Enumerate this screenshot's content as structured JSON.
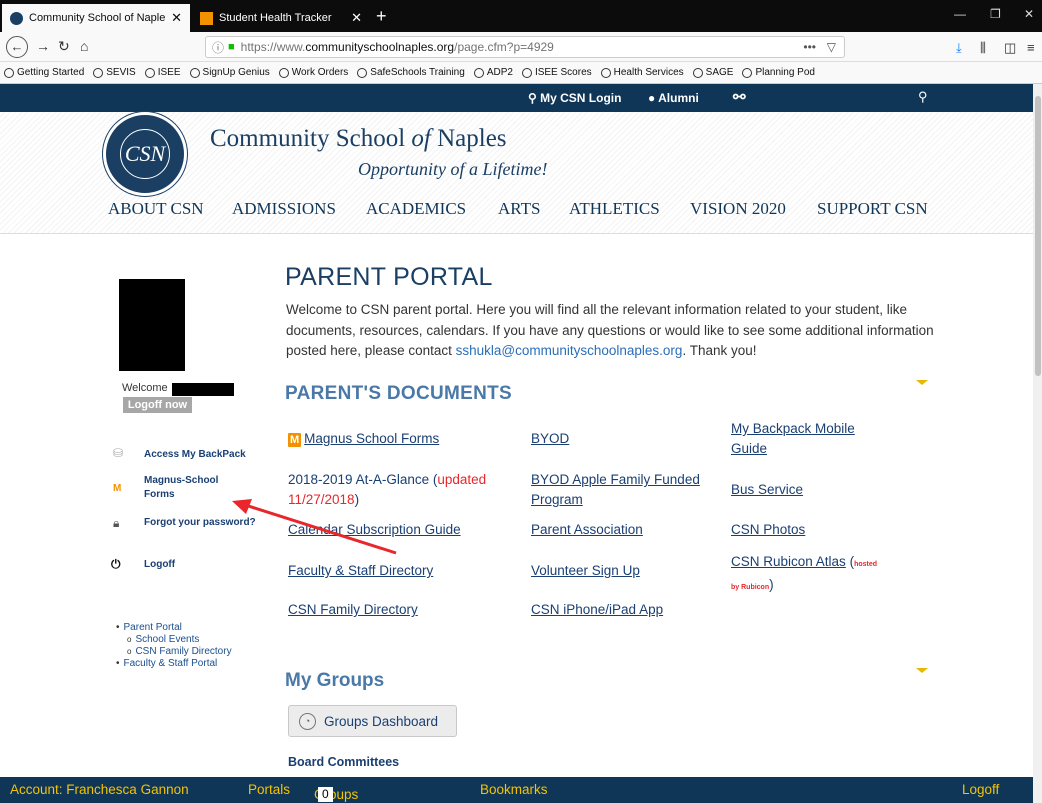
{
  "browser": {
    "tabs": [
      {
        "title": "Community School of Naples |",
        "active": true
      },
      {
        "title": "Student Health Tracker",
        "active": false
      }
    ],
    "url_prefix": "https://www.",
    "url_host": "communityschoolnaples.org",
    "url_path": "/page.cfm?p=4929",
    "bookmarks": [
      "Getting Started",
      "SEVIS",
      "ISEE",
      "SignUp Genius",
      "Work Orders",
      "SafeSchools Training",
      "ADP2",
      "ISEE Scores",
      "Health Services",
      "SAGE",
      "Planning Pod"
    ]
  },
  "site": {
    "topbar": {
      "login": "My CSN Login",
      "alumni": "Alumni"
    },
    "title_main": "Community School ",
    "title_of": "of",
    "title_end": " Naples",
    "tagline": "Opportunity of a Lifetime!",
    "seal_letters": "CSN",
    "nav": [
      "ABOUT CSN",
      "ADMISSIONS",
      "ACADEMICS",
      "ARTS",
      "ATHLETICS",
      "VISION 2020",
      "SUPPORT CSN"
    ]
  },
  "sidebar": {
    "welcome": "Welcome",
    "logoff_now": "Logoff now",
    "links": {
      "backpack": "Access My BackPack",
      "magnus_1": "Magnus-School",
      "magnus_2": "Forms",
      "forgot": "Forgot your password?",
      "logoff": "Logoff"
    },
    "tree": {
      "parent_portal": "Parent Portal",
      "school_events": "School Events",
      "family_directory": "CSN Family Directory",
      "faculty_portal": "Faculty & Staff Portal"
    }
  },
  "main": {
    "title": "PARENT PORTAL",
    "intro_1": "Welcome to CSN parent portal. Here you will find all the relevant information related to your student, like  documents, resources, calendars. If you have any questions or would like to see some additional information posted here, please contact ",
    "intro_email": "sshukla@communityschoolnaples.org",
    "intro_2": ". Thank you!",
    "docs_title": "PARENT'S DOCUMENTS",
    "docs": {
      "magnus": "Magnus School Forms",
      "byod": "BYOD",
      "backpack_guide_1": "My Backpack Mobile",
      "backpack_guide_2": "Guide",
      "ataglance": "2018-2019 At-A-Glance (",
      "ataglance_updated_1": "updated",
      "ataglance_updated_2": "11/27/2018",
      "ataglance_close": ")",
      "byod_apple_1": "BYOD Apple Family Funded",
      "byod_apple_2": "Program",
      "bus": "Bus Service",
      "calendar": "Calendar Subscription Guide",
      "parent_assoc": "Parent Association",
      "photos": "CSN Photos",
      "faculty_dir": "Faculty & Staff Directory",
      "volunteer": "Volunteer Sign Up",
      "rubicon": "CSN Rubicon Atlas",
      "rubicon_paren": " (",
      "rubicon_hosted": "hosted",
      "rubicon_by": "by Rubicon",
      "rubicon_close": ")",
      "family_dir": "CSN Family Directory",
      "iphone": "CSN iPhone/iPad App"
    },
    "groups_title": "My Groups",
    "groups_button": "Groups Dashboard",
    "board_title": "Board Committees"
  },
  "bottombar": {
    "account": "Account: Franchesca Gannon",
    "portals": "Portals",
    "groups": "Groups Dashboard",
    "groups_count": "0",
    "bookmarks": "Bookmarks",
    "logoff": "Logoff"
  },
  "colors": {
    "navy": "#0f3557",
    "accent_yellow": "#f5c400",
    "link_blue": "#1a3f73",
    "annotation_red": "#e8262b"
  }
}
